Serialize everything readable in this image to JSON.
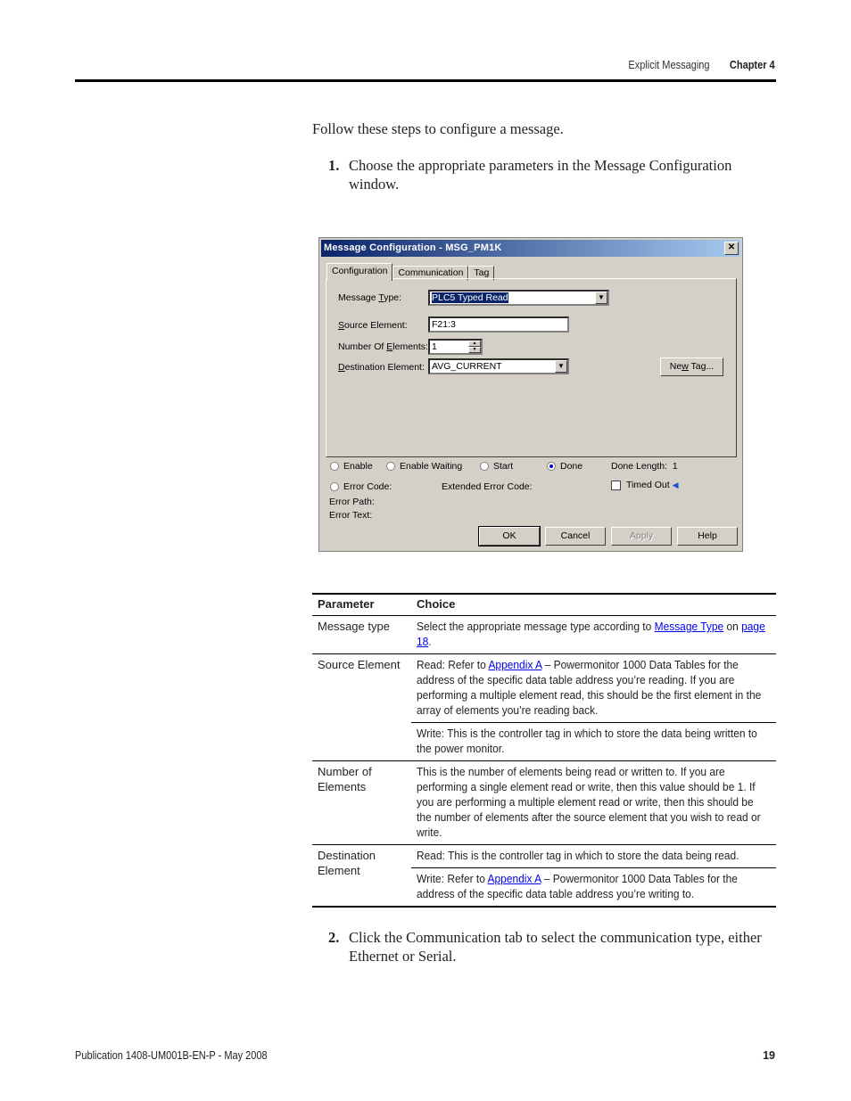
{
  "header": {
    "section": "Explicit Messaging",
    "chapter": "Chapter 4"
  },
  "intro": "Follow these steps to configure a message.",
  "steps": [
    {
      "num": "1.",
      "text": "Choose the appropriate parameters in the Message Configuration window."
    },
    {
      "num": "2.",
      "text": "Click the Communication tab to select the communication type, either Ethernet or Serial."
    }
  ],
  "dialog": {
    "title": "Message Configuration - MSG_PM1K",
    "close_icon": "close-icon",
    "tabs": [
      "Configuration",
      "Communication",
      "Tag"
    ],
    "active_tab": "Configuration",
    "fields": {
      "message_type": {
        "label_pre": "Message ",
        "label_u": "T",
        "label_post": "ype:",
        "value": "PLC5 Typed Read"
      },
      "source_element": {
        "label_u": "S",
        "label_post": "ource Element:",
        "value": "F21:3"
      },
      "number_of_elements": {
        "label_pre": "Number Of ",
        "label_u": "E",
        "label_post": "lements:",
        "value": "1"
      },
      "destination_element": {
        "label_u": "D",
        "label_post": "estination Element:",
        "value": "AVG_CURRENT"
      }
    },
    "new_tag_button": {
      "pre": "Ne",
      "u": "w",
      "post": " Tag..."
    },
    "status": {
      "enable": "Enable",
      "enable_waiting": "Enable Waiting",
      "start": "Start",
      "done": "Done",
      "done_length_label": "Done Length:",
      "done_length_value": "1",
      "error_code": "Error Code:",
      "extended_error_code": "Extended Error Code:",
      "timed_out": "Timed Out",
      "error_path": "Error Path:",
      "error_text": "Error Text:"
    },
    "buttons": {
      "ok": "OK",
      "cancel": "Cancel",
      "apply": "Apply",
      "help": "Help"
    }
  },
  "table": {
    "headers": [
      "Parameter",
      "Choice"
    ],
    "rows": [
      {
        "param": "Message type",
        "choices": [
          {
            "pre": "Select the appropriate message type according to ",
            "link1": "Message Type",
            "mid": " on ",
            "link2": "page 18",
            "post": "."
          }
        ]
      },
      {
        "param": "Source Element",
        "choices": [
          {
            "pre": "Read: Refer to ",
            "link1": "Appendix A",
            "post": " – Powermonitor 1000 Data Tables for the address of the specific data table address you’re reading. If you are performing a multiple element read, this should be the first element in the array of elements you’re reading back."
          },
          {
            "pre": "Write: This is the controller tag in which to store the data being written to the power monitor."
          }
        ]
      },
      {
        "param": "Number of Elements",
        "choices": [
          {
            "pre": "This is the number of elements being read or written to. If you are performing a single element read or write, then this value should be 1. If you are performing a multiple element read or write, then this should be the number of elements after the source element that you wish to read or write."
          }
        ]
      },
      {
        "param": "Destination Element",
        "choices": [
          {
            "pre": "Read: This is the controller tag in which to store the data being read."
          },
          {
            "pre": "Write: Refer to ",
            "link1": "Appendix A",
            "post": " – Powermonitor 1000 Data Tables for the address of the specific data table address you’re writing to."
          }
        ]
      }
    ]
  },
  "footer": {
    "publication": "Publication 1408-UM001B-EN-P - May 2008",
    "page": "19"
  }
}
